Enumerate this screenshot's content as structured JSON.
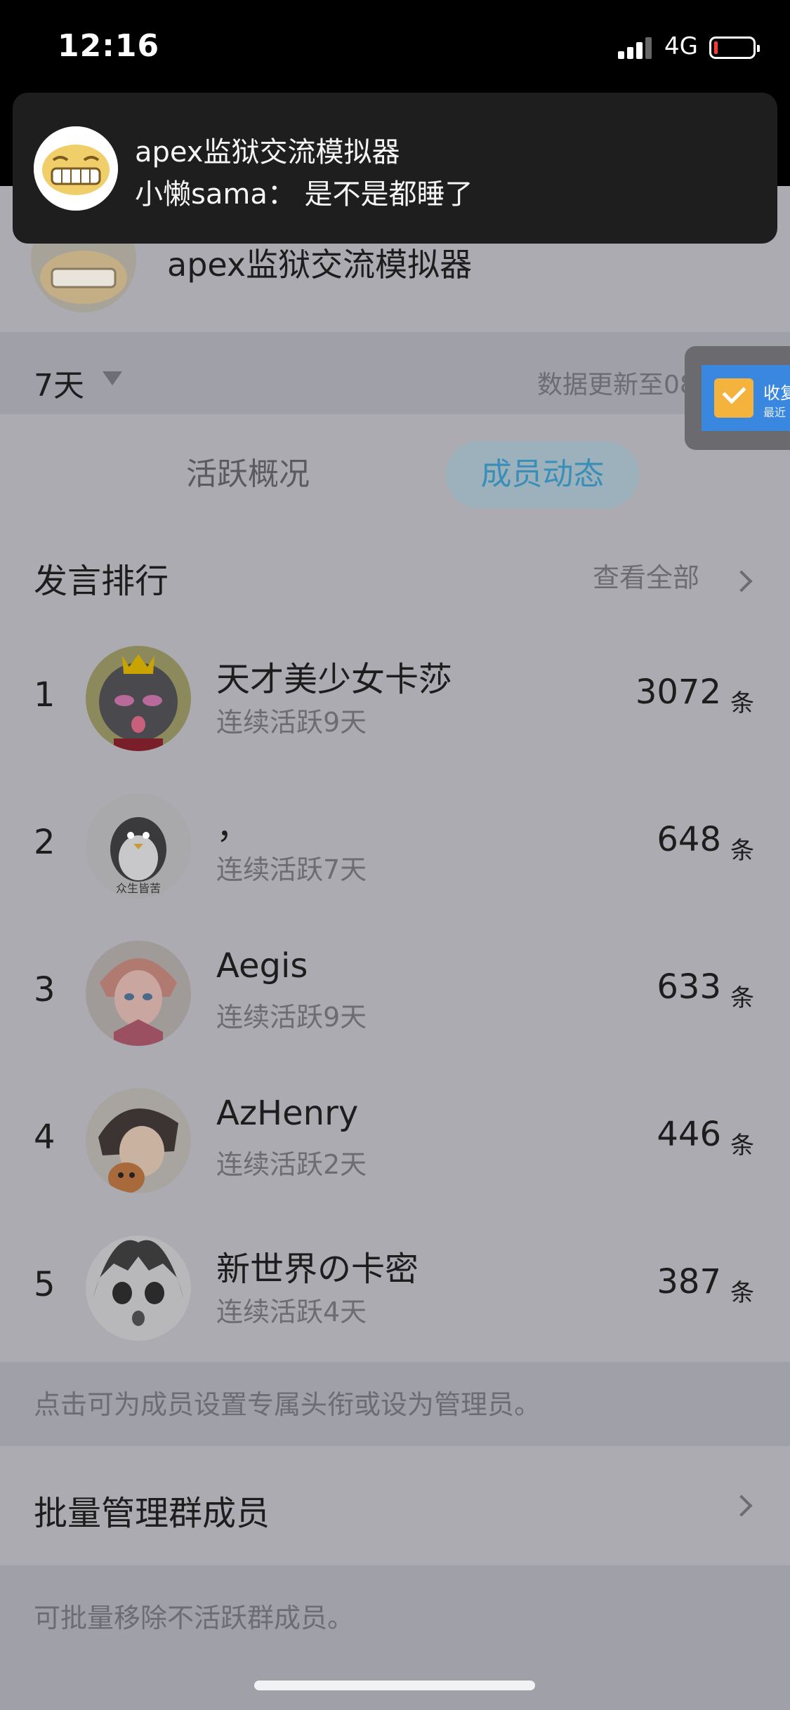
{
  "status_bar": {
    "time": "12:16",
    "network": "4G"
  },
  "notification": {
    "title": "apex监狱交流模拟器",
    "sender": "小懒sama",
    "message": "小懒sama： 是不是都睡了"
  },
  "group": {
    "name": "apex监狱交流模拟器"
  },
  "filter": {
    "period": "7天",
    "update_text": "数据更新至08"
  },
  "floating_widget": {
    "title": "收复",
    "subtitle": "最近"
  },
  "tabs": [
    {
      "label": "活跃概况",
      "active": false
    },
    {
      "label": "成员动态",
      "active": true
    }
  ],
  "ranking": {
    "title": "发言排行",
    "view_all": "查看全部",
    "unit": "条",
    "members": [
      {
        "rank": "1",
        "name": "天才美少女卡莎",
        "streak": "连续活跃9天",
        "count": "3072"
      },
      {
        "rank": "2",
        "name": "，",
        "streak": "连续活跃7天",
        "count": "648"
      },
      {
        "rank": "3",
        "name": "Aegis",
        "streak": "连续活跃9天",
        "count": "633"
      },
      {
        "rank": "4",
        "name": "AzHenry",
        "streak": "连续活跃2天",
        "count": "446"
      },
      {
        "rank": "5",
        "name": "新世界の卡密",
        "streak": "连续活跃4天",
        "count": "387"
      }
    ]
  },
  "avatar_captions": {
    "penguin": "众生皆苦"
  },
  "hint_set_title": "点击可为成员设置专属头衔或设为管理员。",
  "batch_manage": {
    "label": "批量管理群成员"
  },
  "hint_batch": "可批量移除不活跃群成员。",
  "colors": {
    "accent": "#3a8fb8",
    "banner_bg": "#1e1e1e",
    "dim_bg": "#ababb1"
  }
}
